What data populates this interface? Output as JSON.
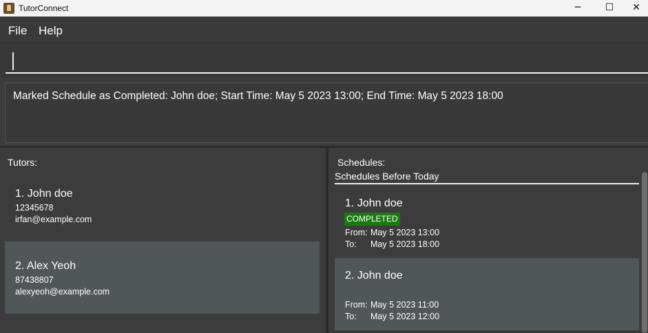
{
  "window": {
    "title": "TutorConnect",
    "controls": {
      "minimize": "─",
      "maximize": "☐",
      "close": "✕"
    }
  },
  "menu": {
    "file": "File",
    "help": "Help"
  },
  "command": {
    "value": ""
  },
  "result": {
    "message": "Marked Schedule as Completed: John doe; Start Time: May 5 2023 13:00; End Time: May 5 2023 18:00"
  },
  "tutors": {
    "label": "Tutors:",
    "items": [
      {
        "name": "1.  John doe",
        "phone": "12345678",
        "email": "irfan@example.com"
      },
      {
        "name": "2.  Alex Yeoh",
        "phone": "87438807",
        "email": "alexyeoh@example.com"
      }
    ]
  },
  "schedules": {
    "label": "Schedules:",
    "section": "Schedules Before Today",
    "items": [
      {
        "name": "1.  John doe",
        "status": "COMPLETED",
        "from_label": "From:",
        "from": "May 5 2023 13:00",
        "to_label": "To:",
        "to": "May 5 2023 18:00"
      },
      {
        "name": "2.  John doe",
        "from_label": "From:",
        "from": "May 5 2023 11:00",
        "to_label": "To:",
        "to": "May 5 2023 12:00"
      }
    ]
  },
  "colors": {
    "background": "#3c3c3c",
    "card_dark": "#3c3c3c",
    "card_light": "#515658",
    "completed_badge": "#1a7a10"
  }
}
